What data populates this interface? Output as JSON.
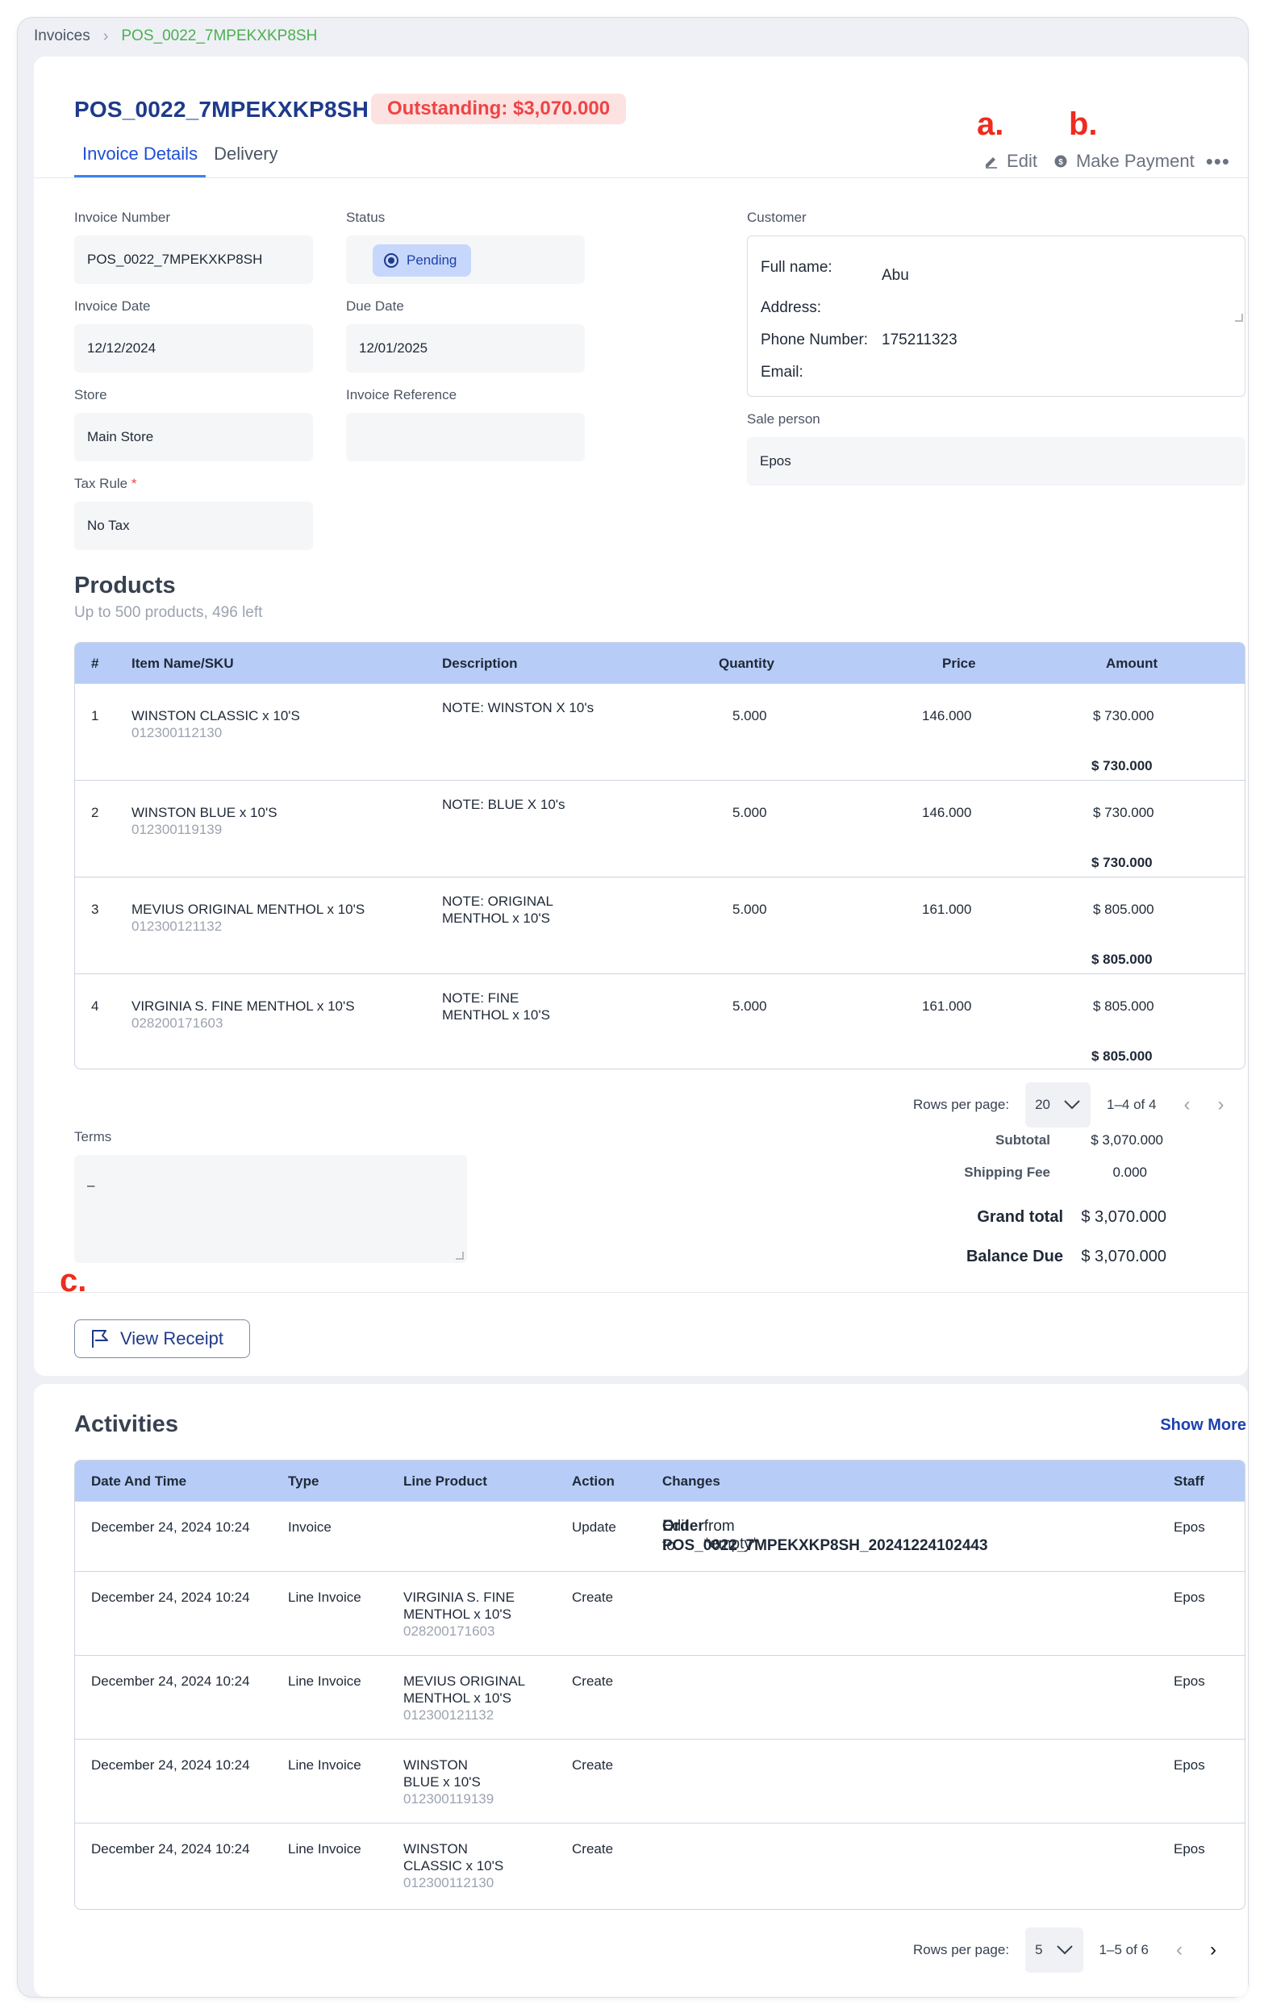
{
  "breadcrumb": {
    "root": "Invoices",
    "current": "POS_0022_7MPEKXKP8SH"
  },
  "invoice": {
    "title": "POS_0022_7MPEKXKP8SH",
    "outstanding": "Outstanding: $3,070.000"
  },
  "tabs": [
    "Invoice Details",
    "Delivery"
  ],
  "annotations": {
    "a": "a.",
    "b": "b.",
    "c": "c."
  },
  "actions": {
    "edit": "Edit",
    "make_payment": "Make Payment"
  },
  "fields": {
    "invoice_number": {
      "label": "Invoice Number",
      "value": "POS_0022_7MPEKXKP8SH"
    },
    "status": {
      "label": "Status",
      "value": "Pending"
    },
    "invoice_date": {
      "label": "Invoice Date",
      "value": "12/12/2024"
    },
    "due_date": {
      "label": "Due Date",
      "value": "12/01/2025"
    },
    "store": {
      "label": "Store",
      "value": "Main Store"
    },
    "invoice_reference": {
      "label": "Invoice Reference",
      "value": ""
    },
    "tax_rule": {
      "label": "Tax Rule",
      "required": "*",
      "value": "No Tax"
    },
    "customer": {
      "label": "Customer",
      "full_name_label": "Full name:",
      "full_name": "Abu",
      "address_label": "Address:",
      "phone_label": "Phone Number:",
      "phone": "175211323",
      "email_label": "Email:"
    },
    "sale_person": {
      "label": "Sale person",
      "value": "Epos"
    }
  },
  "products": {
    "title": "Products",
    "subtitle": "Up to 500 products, 496 left",
    "headers": [
      "#",
      "Item Name/SKU",
      "Description",
      "Quantity",
      "Price",
      "Amount"
    ],
    "rows": [
      {
        "num": "1",
        "name": "WINSTON CLASSIC x 10'S",
        "sku": "012300112130",
        "desc1": "NOTE: WINSTON X 10's",
        "desc2": "",
        "qty": "5.000",
        "price": "146.000",
        "amount": "$ 730.000",
        "total": "$ 730.000"
      },
      {
        "num": "2",
        "name": "WINSTON BLUE x 10'S",
        "sku": "012300119139",
        "desc1": "NOTE: BLUE X 10's",
        "desc2": "",
        "qty": "5.000",
        "price": "146.000",
        "amount": "$ 730.000",
        "total": "$ 730.000"
      },
      {
        "num": "3",
        "name": "MEVIUS ORIGINAL MENTHOL x 10'S",
        "sku": "012300121132",
        "desc1": "NOTE: ORIGINAL",
        "desc2": "MENTHOL x 10'S",
        "qty": "5.000",
        "price": "161.000",
        "amount": "$ 805.000",
        "total": "$ 805.000"
      },
      {
        "num": "4",
        "name": "VIRGINIA S. FINE MENTHOL x 10'S",
        "sku": "028200171603",
        "desc1": "NOTE: FINE",
        "desc2": "MENTHOL x 10'S",
        "qty": "5.000",
        "price": "161.000",
        "amount": "$ 805.000",
        "total": "$ 805.000"
      }
    ],
    "pager": {
      "label": "Rows per page:",
      "value": "20",
      "range": "1–4 of 4"
    }
  },
  "terms": {
    "label": "Terms",
    "value": "–"
  },
  "totals": {
    "subtotal_label": "Subtotal",
    "subtotal": "$ 3,070.000",
    "shipping_label": "Shipping Fee",
    "shipping": "0.000",
    "grand_label": "Grand total",
    "grand": "$ 3,070.000",
    "balance_label": "Balance Due",
    "balance": "$ 3,070.000"
  },
  "view_receipt": "View Receipt",
  "activities": {
    "title": "Activities",
    "show_more": "Show More",
    "headers": [
      "Date And Time",
      "Type",
      "Line Product",
      "Action",
      "Changes",
      "Staff"
    ],
    "rows": [
      {
        "date": "December 24, 2024 10:24",
        "type": "Invoice",
        "prod1": "",
        "prod2": "",
        "sku": "",
        "action": "Update",
        "ch_pre": "Edit ",
        "ch_bold": "Order",
        "ch_mid": " from *empty*",
        "ch_to": "to ",
        "ch_val": "POS_0022_7MPEKXKP8SH_20241224102443",
        "staff": "Epos"
      },
      {
        "date": "December 24, 2024 10:24",
        "type": "Line Invoice",
        "prod1": "VIRGINIA S. FINE",
        "prod2": "MENTHOL x 10'S",
        "sku": "028200171603",
        "action": "Create",
        "staff": "Epos"
      },
      {
        "date": "December 24, 2024 10:24",
        "type": "Line Invoice",
        "prod1": "MEVIUS ORIGINAL",
        "prod2": "MENTHOL x 10'S",
        "sku": "012300121132",
        "action": "Create",
        "staff": "Epos"
      },
      {
        "date": "December 24, 2024 10:24",
        "type": "Line Invoice",
        "prod1": "WINSTON",
        "prod2": "BLUE x 10'S",
        "sku": "012300119139",
        "action": "Create",
        "staff": "Epos"
      },
      {
        "date": "December 24, 2024 10:24",
        "type": "Line Invoice",
        "prod1": "WINSTON",
        "prod2": "CLASSIC x 10'S",
        "sku": "012300112130",
        "action": "Create",
        "staff": "Epos"
      }
    ],
    "pager": {
      "label": "Rows per page:",
      "value": "5",
      "range": "1–5 of 6"
    }
  },
  "colors": {
    "accent": "#1e3a8a",
    "header_bg": "#b7cdf8",
    "outstanding_bg": "#fde2e2",
    "outstanding_text": "#ef4444",
    "annotation": "#ef2b1f",
    "breadcrumb_current": "#4caf50"
  }
}
